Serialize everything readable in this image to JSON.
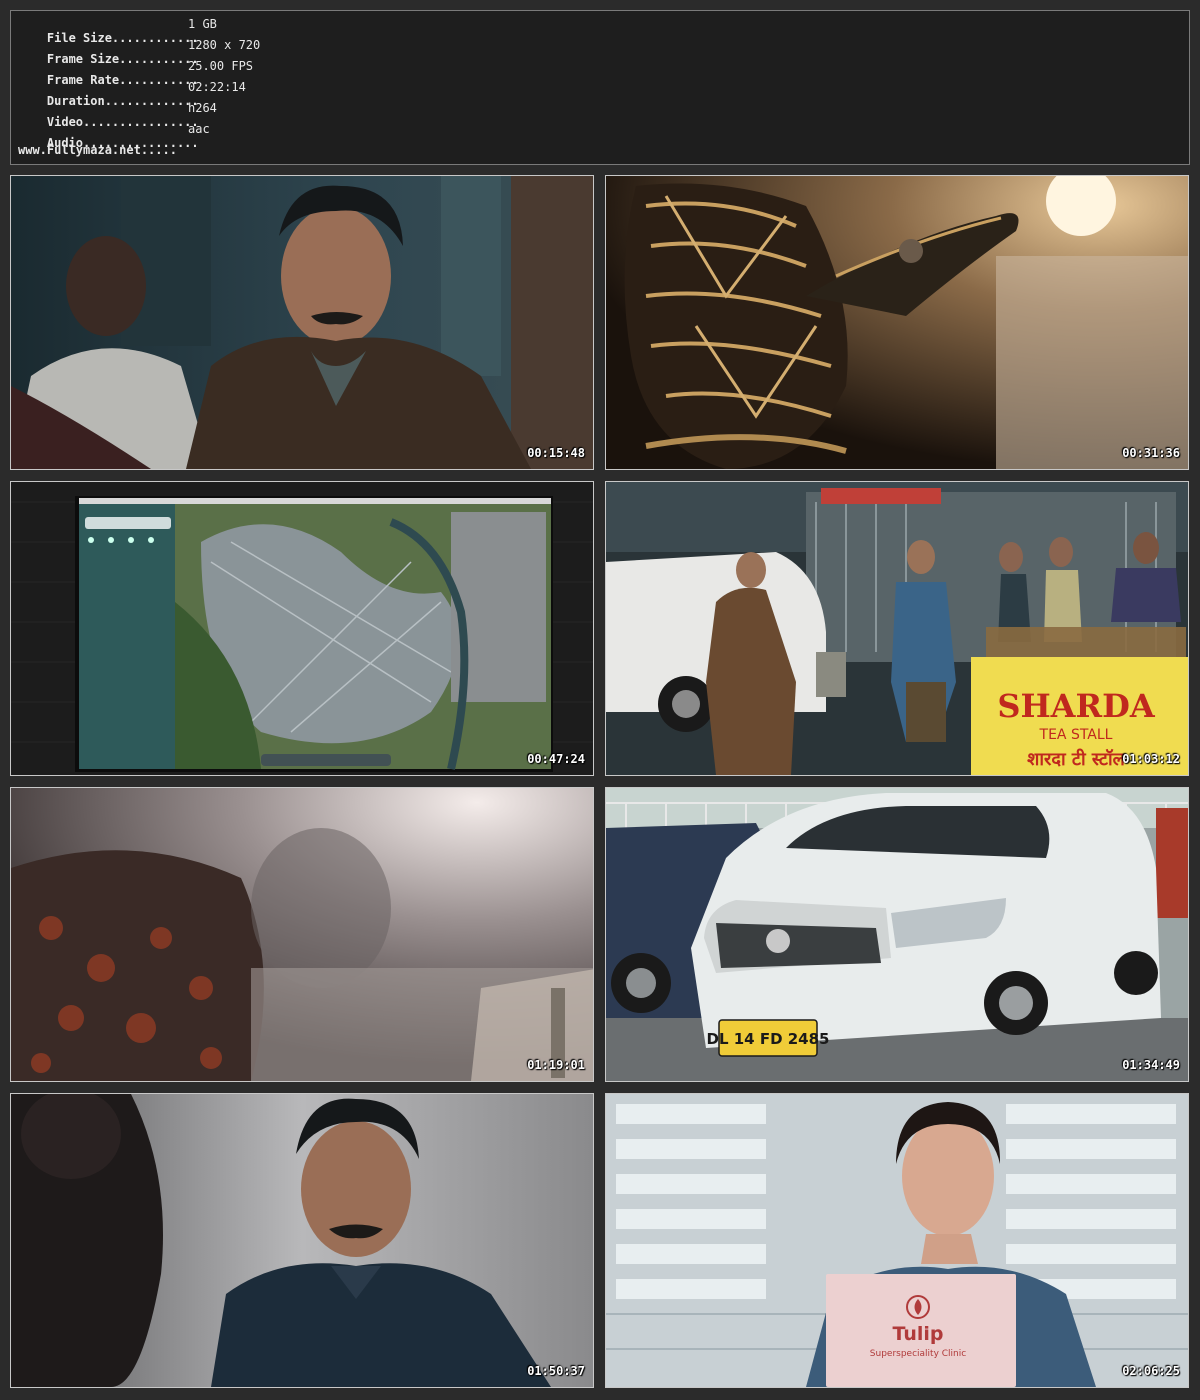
{
  "info": [
    {
      "key": "File Size............",
      "value": "1 GB"
    },
    {
      "key": "Frame Size...........",
      "value": "1280 x 720"
    },
    {
      "key": "Frame Rate...........",
      "value": "25.00 FPS"
    },
    {
      "key": "Duration.............",
      "value": "02:22:14"
    },
    {
      "key": "Video................",
      "value": "h264"
    },
    {
      "key": "Audio................",
      "value": "aac"
    }
  ],
  "footer": "www.Fullymaza.net.....",
  "thumbnails": [
    {
      "timestamp": "00:15:48"
    },
    {
      "timestamp": "00:31:36"
    },
    {
      "timestamp": "00:47:24"
    },
    {
      "timestamp": "01:03:12"
    },
    {
      "timestamp": "01:19:01"
    },
    {
      "timestamp": "01:34:49"
    },
    {
      "timestamp": "01:50:37"
    },
    {
      "timestamp": "02:06:25"
    }
  ],
  "scene_text": {
    "stall_name": "SHARDA",
    "stall_sub": "TEA STALL",
    "stall_hindi": "शारदा टी स्टॉल",
    "plate": "DL 14 FD 2485",
    "clinic_name": "Tulip",
    "clinic_sub": "Superspeciality Clinic"
  }
}
